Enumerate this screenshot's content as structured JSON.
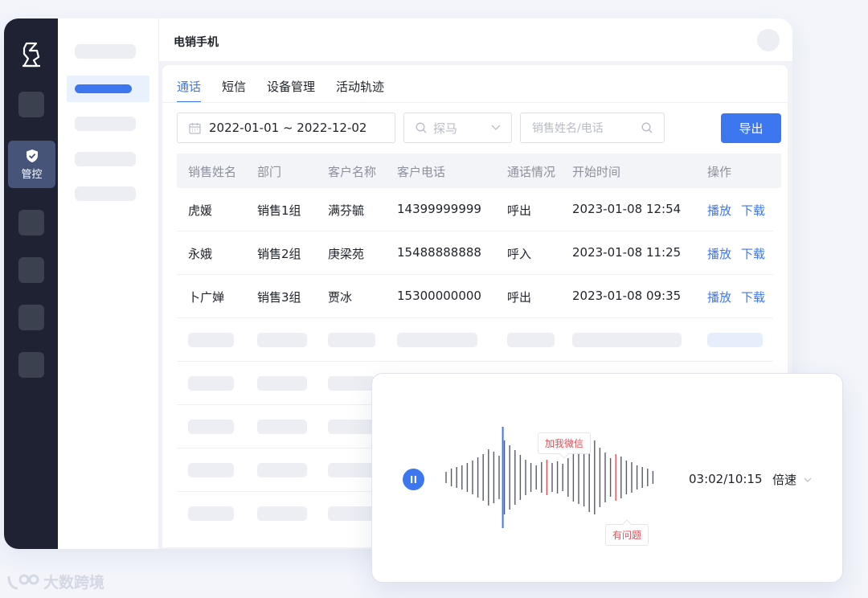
{
  "app": {
    "title": "电销手机",
    "nav": {
      "active_label": "管控"
    }
  },
  "tabs": [
    {
      "label": "通话",
      "active": true
    },
    {
      "label": "短信",
      "active": false
    },
    {
      "label": "设备管理",
      "active": false
    },
    {
      "label": "活动轨迹",
      "active": false
    }
  ],
  "filters": {
    "date_range": "2022-01-01 ~ 2022-12-02",
    "department_placeholder": "探马",
    "search_placeholder": "销售姓名/电话",
    "export_label": "导出"
  },
  "table": {
    "headers": [
      "销售姓名",
      "部门",
      "客户名称",
      "客户电话",
      "通话情况",
      "开始时间",
      "操作"
    ],
    "rows": [
      {
        "sales": "虎媛",
        "dept": "销售1组",
        "customer": "满芬毓",
        "phone": "14399999999",
        "status": "呼出",
        "start": "2023-01-08 12:54",
        "play": "播放",
        "download": "下载"
      },
      {
        "sales": "永娥",
        "dept": "销售2组",
        "customer": "庚梁苑",
        "phone": "15488888888",
        "status": "呼入",
        "start": "2023-01-08 11:25",
        "play": "播放",
        "download": "下载"
      },
      {
        "sales": "卜广婵",
        "dept": "销售3组",
        "customer": "贾冰",
        "phone": "15300000000",
        "status": "呼出",
        "start": "2023-01-08 09:35",
        "play": "播放",
        "download": "下载"
      }
    ]
  },
  "player": {
    "time": "03:02/10:15",
    "speed_label": "倍速",
    "tag_top": "加我微信",
    "tag_bottom": "有问题"
  },
  "watermark": "大数跨境",
  "colors": {
    "accent": "#3d77f0",
    "rail": "#1e2233",
    "marker": "#e0505a"
  }
}
